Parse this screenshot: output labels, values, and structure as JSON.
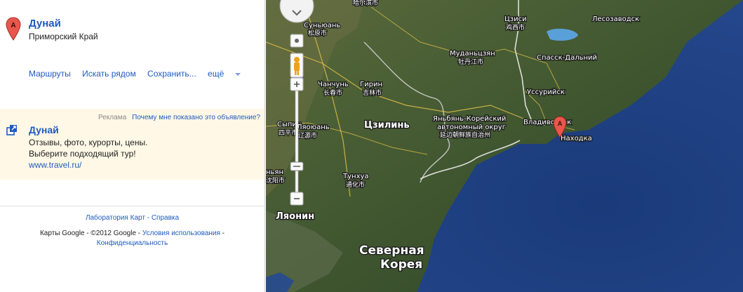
{
  "place": {
    "marker_letter": "A",
    "title": "Дунай",
    "subtitle": "Приморский Край"
  },
  "actions": {
    "routes": "Маршруты",
    "search_nearby": "Искать рядом",
    "save": "Сохранить...",
    "more": "ещё"
  },
  "ad": {
    "label": "Реклама",
    "why": "Почему мне показано это объявление?",
    "title": "Дунай",
    "line1": "Отзывы, фото, курорты, цены.",
    "line2": "Выберите подходящий тур!",
    "url": "www.travel.ru/"
  },
  "footer": {
    "labs": "Лаборатория Карт",
    "sep": " - ",
    "help": "Справка",
    "copyright": "Карты Google - ©2012 Google - ",
    "terms": "Условия использования",
    "dash": " -",
    "privacy": "Конфиденциальность"
  },
  "map": {
    "marker_letter": "A",
    "labels": {
      "lesozavodsk": "Лесозаводск",
      "jixi_ru": "Цзиси",
      "jixi_zh": "鸡西市",
      "sunyuan_ru": "Суньюань",
      "sunyuan_zh": "松原市",
      "mudanjiang_ru": "Муданьцзян",
      "mudanjiang_zh": "牡丹江市",
      "spassk": "Спасск-Дальний",
      "changchun_ru": "Чанчунь",
      "changchun_zh": "长春市",
      "jilin_ru": "Гирин",
      "jilin_zh": "吉林市",
      "ussuriysk": "Уссурийск",
      "yanbian_1": "Яньбянь-Корейский",
      "yanbian_2": "автономный округ",
      "yanbian_zh": "延边朝鲜族自治州",
      "vladivostok": "Владивосток",
      "nakhodka": "Находка",
      "jilin_province": "Цзилинь",
      "sypin_ru": "Сыпин",
      "sypin_zh": "四平市",
      "liaoyuan_ru": "Ляоюань",
      "liaoyuan_zh": "辽源市",
      "shenyang_ru": "ньян",
      "shenyang_zh": "沈阳市",
      "tonghua_ru": "Тунхуа",
      "tonghua_zh": "通化市",
      "liaoning": "Ляонин",
      "north_korea_1": "Северная",
      "north_korea_2": "Корея",
      "top_city_zh": "哈尔滨市"
    }
  }
}
